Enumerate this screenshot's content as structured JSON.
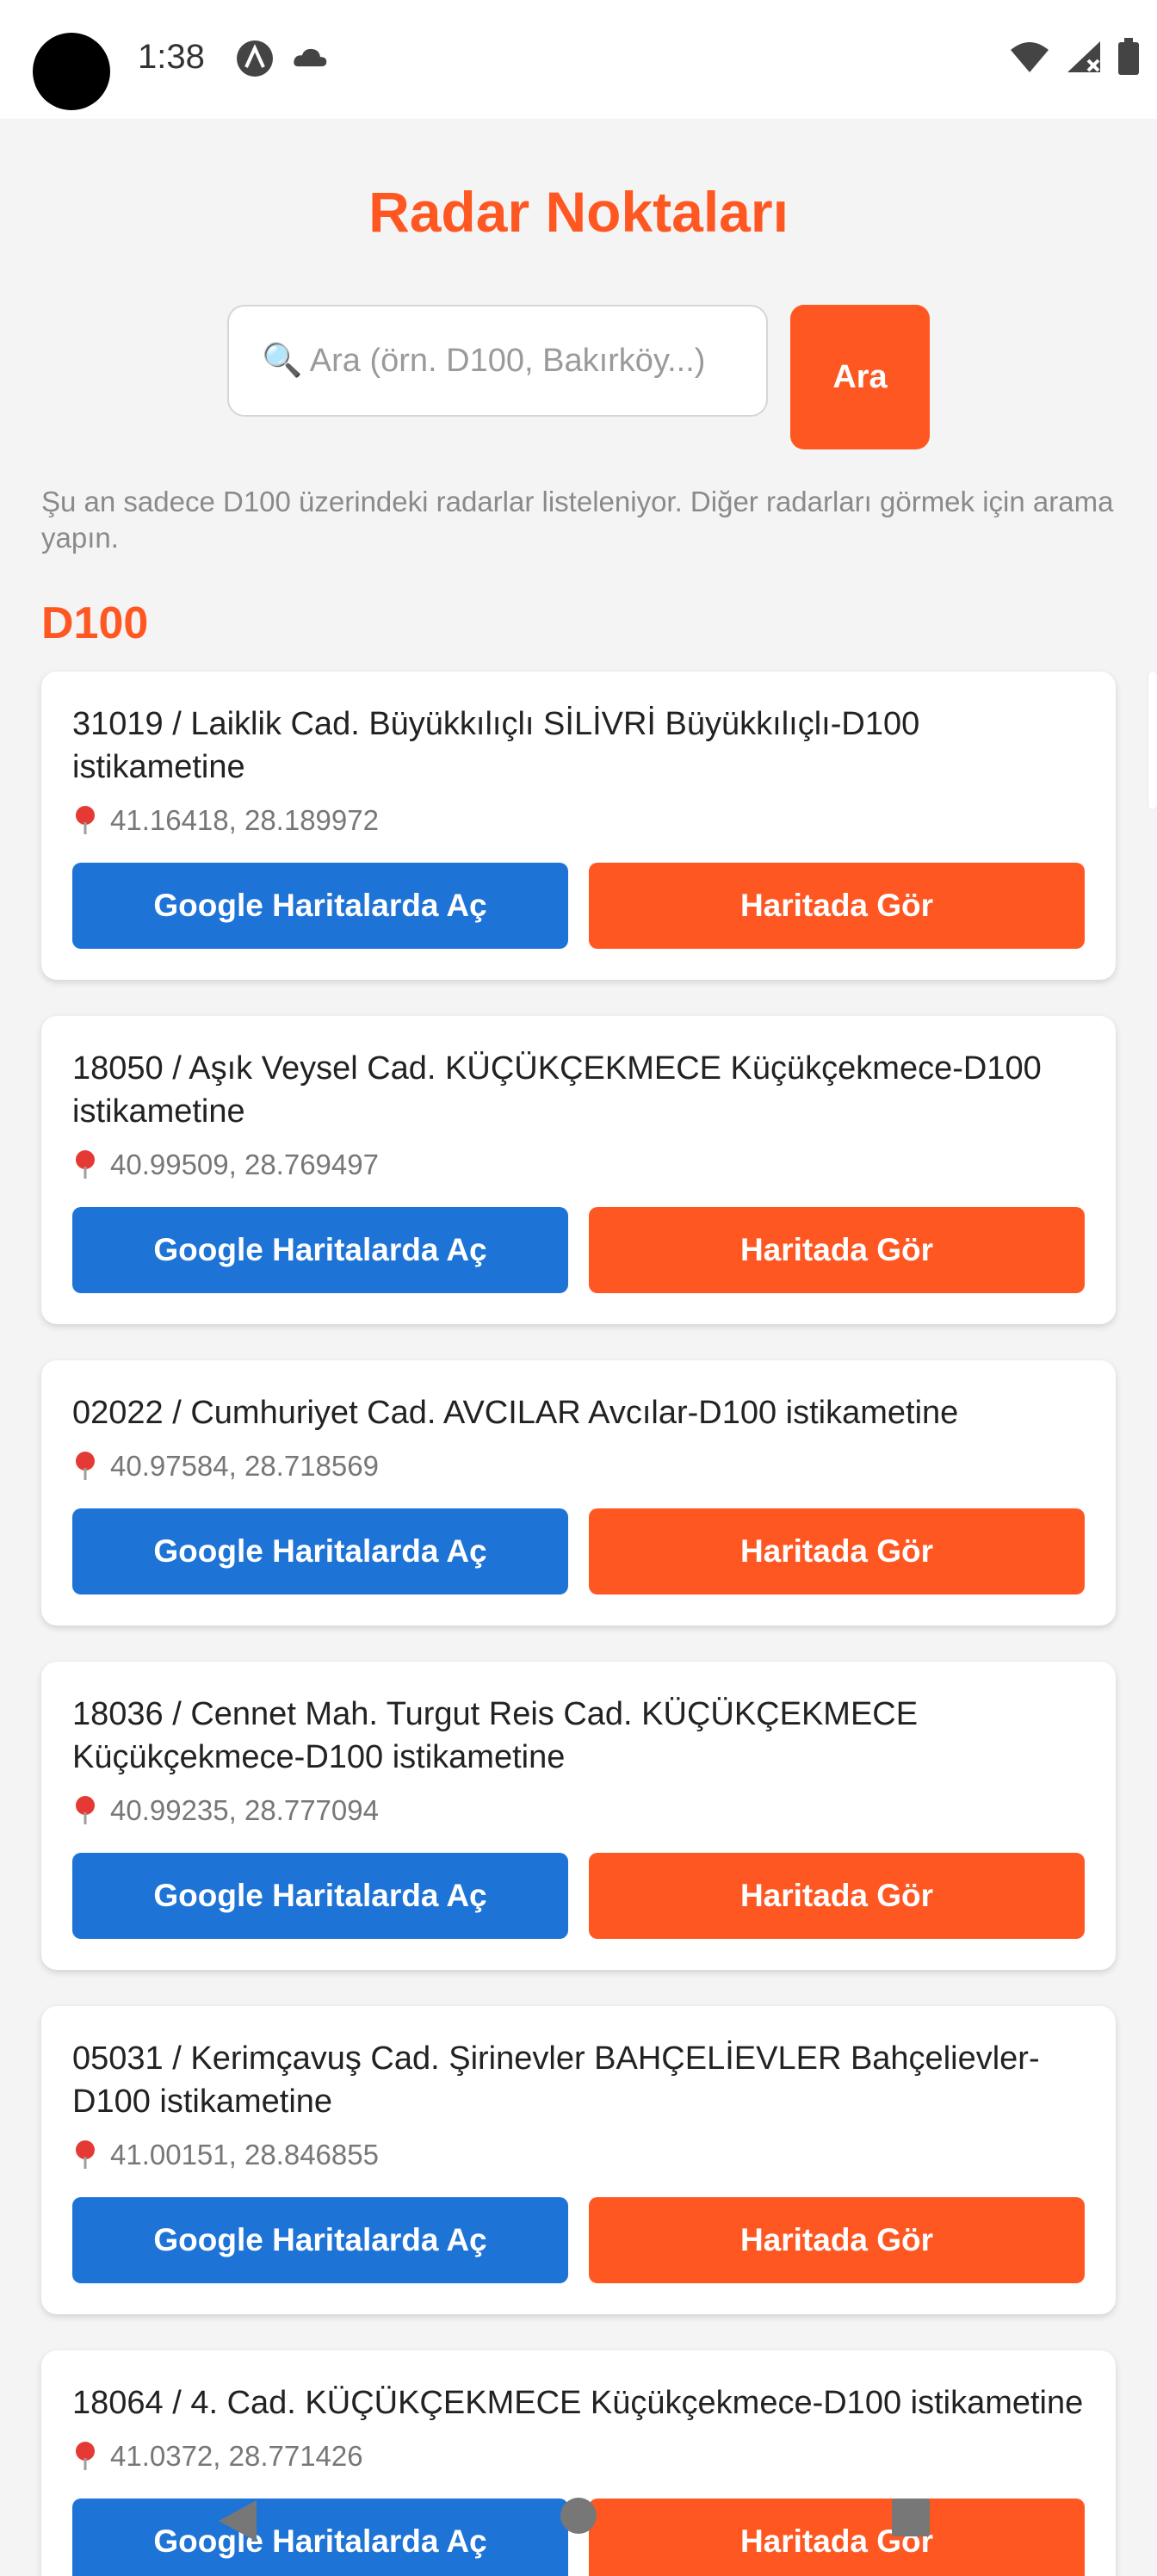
{
  "status_bar": {
    "time": "1:38",
    "left_icons": [
      "a-badge-icon",
      "cloud-icon"
    ],
    "right_icons": [
      "wifi-icon",
      "signal-icon",
      "battery-icon"
    ]
  },
  "page_title": "Radar Noktaları",
  "search": {
    "placeholder": "🔍 Ara (örn. D100, Bakırköy...)",
    "button_label": "Ara"
  },
  "info_text": "Şu an sadece D100 üzerindeki radarlar listeleniyor. Diğer radarları görmek için arama yapın.",
  "section_title": "D100",
  "actions": {
    "google_label": "Google Haritalarda Aç",
    "map_label": "Haritada Gör"
  },
  "radars": [
    {
      "title": "31019 / Laiklik Cad. Büyükkılıçlı SİLİVRİ Büyükkılıçlı-D100 istikametine",
      "coords": "41.16418, 28.189972"
    },
    {
      "title": "18050 / Aşık Veysel Cad. KÜÇÜKÇEKMECE Küçükçekmece-D100 istikametine",
      "coords": "40.99509, 28.769497"
    },
    {
      "title": "02022 / Cumhuriyet Cad. AVCILAR  Avcılar-D100 istikametine",
      "coords": "40.97584, 28.718569"
    },
    {
      "title": "18036 / Cennet Mah. Turgut Reis Cad. KÜÇÜKÇEKMECE Küçükçekmece-D100 istikametine",
      "coords": "40.99235, 28.777094"
    },
    {
      "title": "05031 / Kerimçavuş Cad. Şirinevler BAHÇELİEVLER Bahçelievler-D100 istikametine",
      "coords": "41.00151, 28.846855"
    },
    {
      "title": "18064 / 4. Cad. KÜÇÜKÇEKMECE  Küçükçekmece-D100 istikametine",
      "coords": "41.0372, 28.771426"
    }
  ],
  "colors": {
    "accent": "#ff5722",
    "google_blue": "#1e74d6",
    "background": "#f4f4f4"
  }
}
